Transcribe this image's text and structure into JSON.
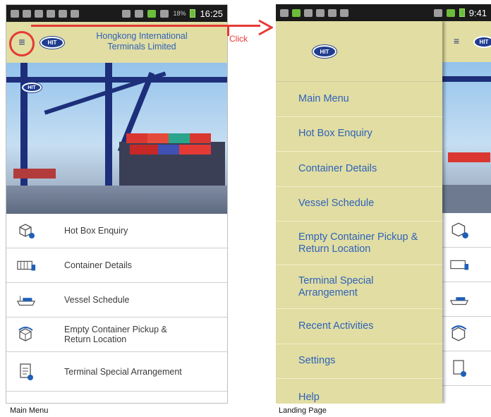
{
  "status_left": {
    "time": "16:25",
    "battery_pct": "18%"
  },
  "status_right": {
    "time": "9:41"
  },
  "app": {
    "title_line1": "Hongkong International",
    "title_line2": "Terminals Limited",
    "logo_text": "HIT"
  },
  "main_menu": [
    {
      "label": "Hot Box Enquiry",
      "icon": "hot-box-icon"
    },
    {
      "label": "Container Details",
      "icon": "container-icon"
    },
    {
      "label": "Vessel Schedule",
      "icon": "vessel-icon"
    },
    {
      "label": "Empty Container Pickup &",
      "label2": "Return Location",
      "icon": "empty-container-icon"
    },
    {
      "label": "Terminal Special Arrangement",
      "icon": "document-icon"
    }
  ],
  "drawer": [
    {
      "label": "Main Menu"
    },
    {
      "label": "Hot Box Enquiry"
    },
    {
      "label": "Container Details"
    },
    {
      "label": "Vessel Schedule"
    },
    {
      "label": "Empty Container Pickup &",
      "label2": "Return Location"
    },
    {
      "label": "Terminal Special",
      "label2": "Arrangement"
    },
    {
      "label": "Recent Activities"
    },
    {
      "label": "Settings"
    },
    {
      "label": "Help"
    }
  ],
  "annotation": {
    "click_label": "Click"
  },
  "captions": {
    "left": "Main Menu",
    "right": "Landing Page"
  },
  "colors": {
    "header_bg": "#e1dda3",
    "accent_blue": "#2f63b8",
    "annotation_red": "#e53935"
  }
}
